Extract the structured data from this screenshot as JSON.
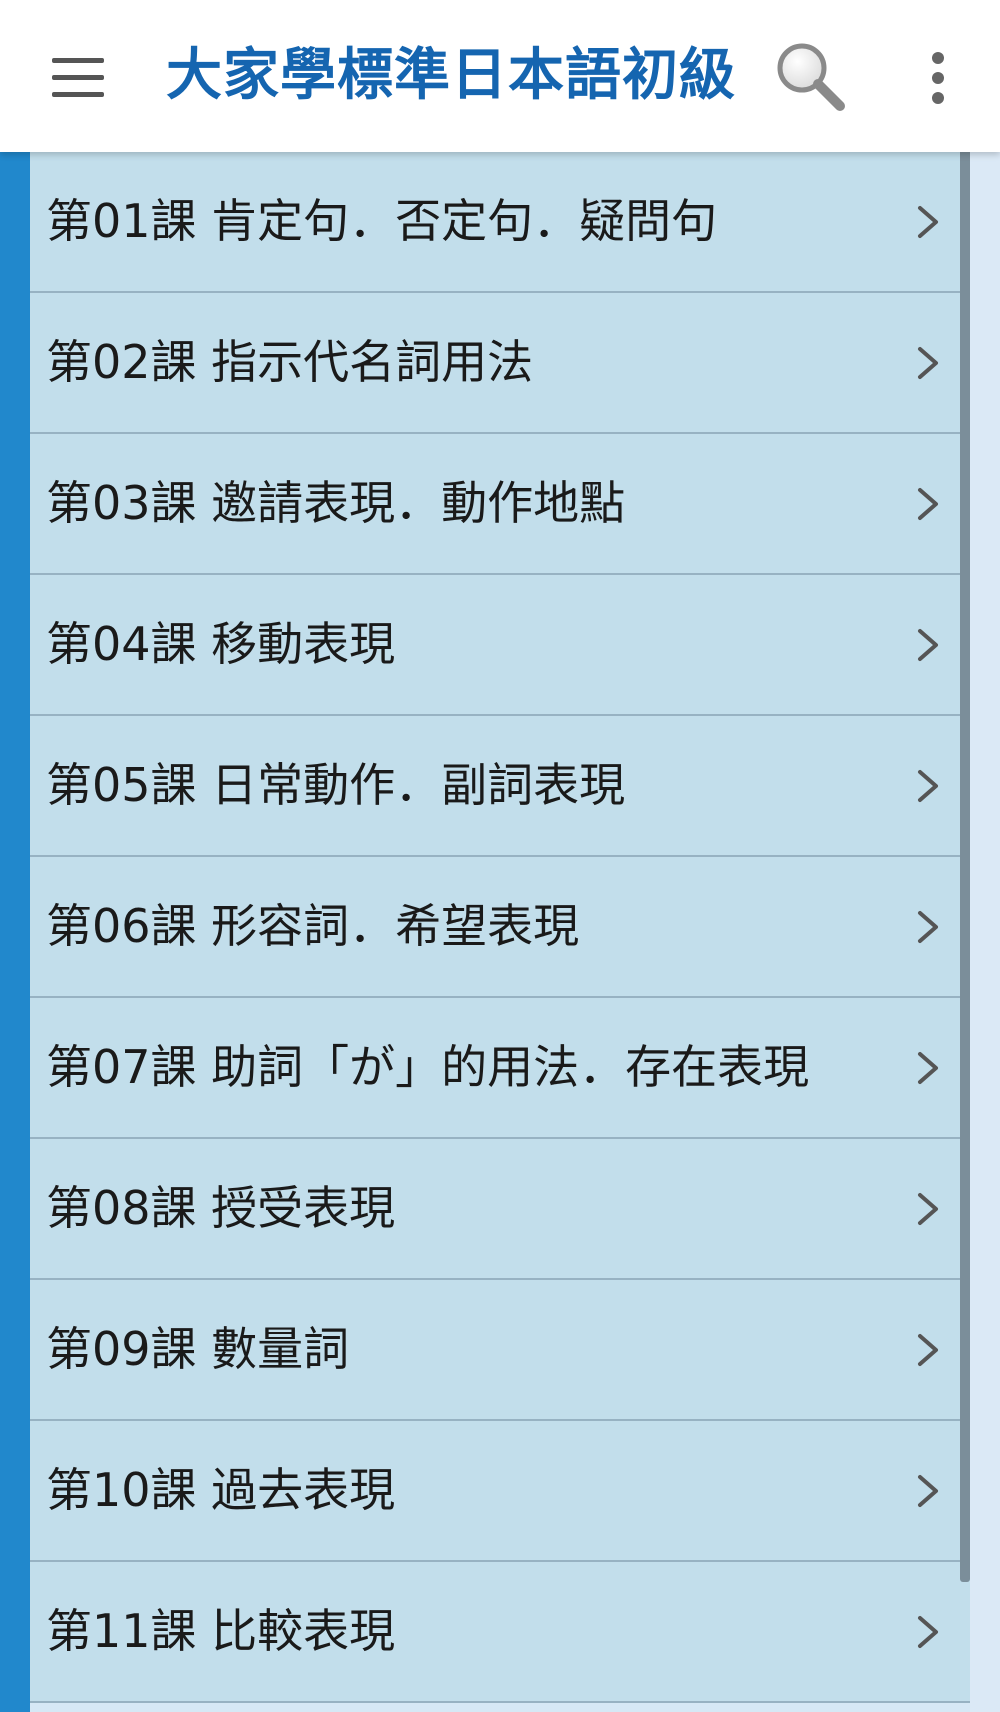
{
  "app_bar": {
    "title": "大家學標準日本語初級",
    "title_color": "#1565b0",
    "icons": {
      "menu": "hamburger-menu-icon",
      "search": "search-icon",
      "more": "more-vertical-icon"
    }
  },
  "lessons": [
    {
      "label": "第01課 肯定句．否定句．疑問句"
    },
    {
      "label": "第02課 指示代名詞用法"
    },
    {
      "label": "第03課 邀請表現．動作地點"
    },
    {
      "label": "第04課 移動表現"
    },
    {
      "label": "第05課 日常動作．副詞表現"
    },
    {
      "label": "第06課 形容詞．希望表現"
    },
    {
      "label": "第07課 助詞「が」的用法．存在表現"
    },
    {
      "label": "第08課 授受表現"
    },
    {
      "label": "第09課 數量詞"
    },
    {
      "label": "第10課 過去表現"
    },
    {
      "label": "第11課 比較表現"
    }
  ],
  "colors": {
    "accent": "#2188cc",
    "list_background": "#c2deeb",
    "divider": "#97b2c2"
  }
}
